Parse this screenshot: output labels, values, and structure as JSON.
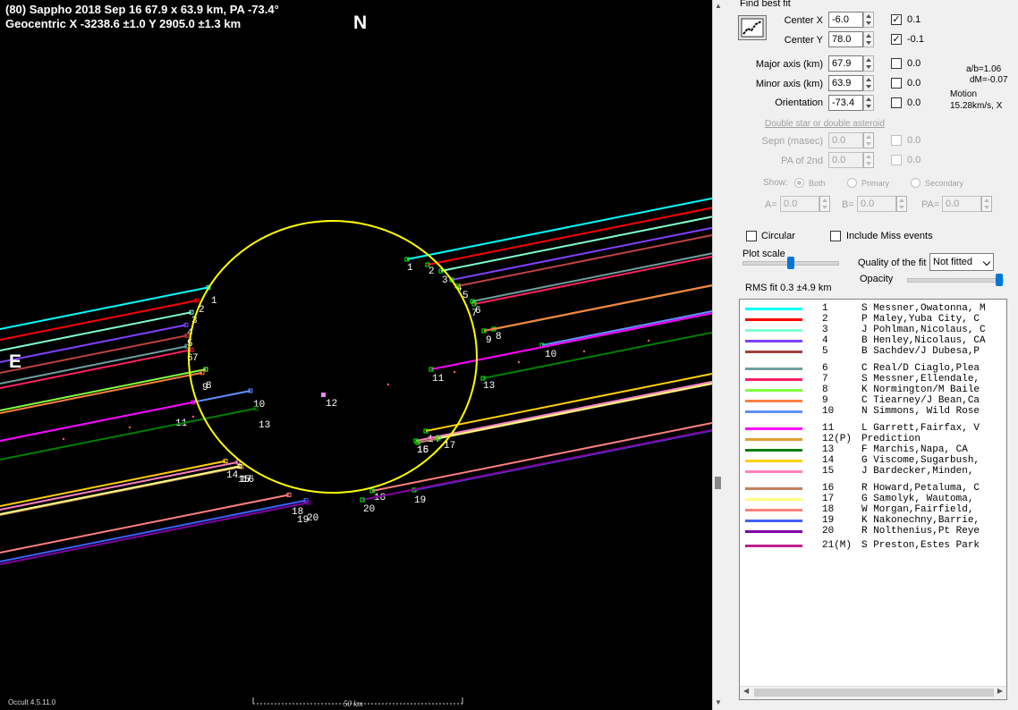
{
  "plot": {
    "title_line1": "(80) Sappho  2018 Sep 16  67.9 x 63.9 km, PA -73.4°",
    "title_line2": "Geocentric  X  -3238.6 ±1.0  Y 2905.0 ±1.3 km",
    "north_label": "N",
    "east_label": "E",
    "version": "Occult 4.5.11.0",
    "scale_label": "50 km",
    "center_label": "12",
    "ellipse_color": "#ffff00",
    "chords": [
      {
        "id": "1",
        "color": "#00ffff"
      },
      {
        "id": "2",
        "color": "#ff0000"
      },
      {
        "id": "3",
        "color": "#80ffd0"
      },
      {
        "id": "4",
        "color": "#8040ff"
      },
      {
        "id": "5",
        "color": "#c04040"
      },
      {
        "id": "6",
        "color": "#70a0a0"
      },
      {
        "id": "7",
        "color": "#ff2060"
      },
      {
        "id": "8",
        "color": "#80ff40"
      },
      {
        "id": "9",
        "color": "#ff8040"
      },
      {
        "id": "10",
        "color": "#6090ff"
      },
      {
        "id": "11",
        "color": "#ff00ff"
      },
      {
        "id": "13",
        "color": "#008000"
      },
      {
        "id": "14",
        "color": "#ffd000"
      },
      {
        "id": "15",
        "color": "#ff80c0"
      },
      {
        "id": "16",
        "color": "#c08060"
      },
      {
        "id": "17",
        "color": "#ffff80"
      },
      {
        "id": "18",
        "color": "#ff8080"
      },
      {
        "id": "19",
        "color": "#4060ff"
      },
      {
        "id": "20",
        "color": "#8000a0"
      }
    ]
  },
  "panel": {
    "find_best_fit": "Find best fit",
    "center_x": {
      "label": "Center X",
      "value": "-6.0",
      "check": "✓",
      "err": "0.1"
    },
    "center_y": {
      "label": "Center Y",
      "value": "78.0",
      "check": "✓",
      "err": "-0.1"
    },
    "major": {
      "label": "Major axis (km)",
      "value": "67.9",
      "err": "0.0"
    },
    "minor": {
      "label": "Minor axis (km)",
      "value": "63.9",
      "err": "0.0"
    },
    "orient": {
      "label": "Orientation",
      "value": "-73.4",
      "err": "0.0"
    },
    "ab_ratio": "a/b=1.06",
    "dm": "dM=-0.07",
    "motion_label": "Motion",
    "motion_value": "15.28km/s, X",
    "double_heading": "Double star  or  double asteroid",
    "sepn": {
      "label": "Sepn (masec)",
      "value": "0.0",
      "err": "0.0"
    },
    "pa2": {
      "label": "PA of 2nd",
      "value": "0.0",
      "err": "0.0"
    },
    "show_label": "Show:",
    "show_both": "Both",
    "show_primary": "Primary",
    "show_secondary": "Secondary",
    "a_label": "A=",
    "a_value": "0.0",
    "b_label": "B=",
    "b_value": "0.0",
    "pa_label": "PA=",
    "pa_value": "0.0",
    "circular": "Circular",
    "include_miss": "Include Miss events",
    "plot_scale": "Plot scale",
    "quality_label": "Quality of the fit",
    "quality_value": "Not fitted",
    "opacity": "Opacity",
    "rms_fit": "RMS fit 0.3 ±4.9 km"
  },
  "legend": [
    {
      "code": "1",
      "name": "S Messner,Owatonna, M",
      "color": "#00ffff"
    },
    {
      "code": "2",
      "name": "P Maley,Yuba City, C",
      "color": "#ff0000"
    },
    {
      "code": "3",
      "name": "J Pohlman,Nicolaus, C",
      "color": "#80ffd0"
    },
    {
      "code": "4",
      "name": "B Henley,Nicolaus, CA",
      "color": "#8040ff"
    },
    {
      "code": "5",
      "name": "B Sachdev/J Dubesa,P",
      "color": "#a04040"
    },
    {
      "code": "6",
      "name": "C Real/D Ciaglo,Plea",
      "color": "#70a0a0"
    },
    {
      "code": "7",
      "name": "S Messner,Ellendale,",
      "color": "#ff2060"
    },
    {
      "code": "8",
      "name": "K Normington/M Baile",
      "color": "#80ff40"
    },
    {
      "code": "9",
      "name": "C Tiearney/J Bean,Ca",
      "color": "#ff8040"
    },
    {
      "code": "10",
      "name": "N Simmons, Wild Rose",
      "color": "#6090ff"
    },
    {
      "code": "11",
      "name": "L Garrett,Fairfax, V",
      "color": "#ff00ff"
    },
    {
      "code": "12(P)",
      "name": "Prediction",
      "color": "#e0a030"
    },
    {
      "code": "13",
      "name": "F Marchis,Napa, CA",
      "color": "#008000"
    },
    {
      "code": "14",
      "name": "G Viscome,Sugarbush,",
      "color": "#ffd000"
    },
    {
      "code": "15",
      "name": "J Bardecker,Minden, ",
      "color": "#ff80c0"
    },
    {
      "code": "16",
      "name": "R Howard,Petaluma, C",
      "color": "#c08060"
    },
    {
      "code": "17",
      "name": "G Samolyk, Wautoma, ",
      "color": "#ffff80"
    },
    {
      "code": "18",
      "name": "W Morgan,Fairfield, ",
      "color": "#ff8080"
    },
    {
      "code": "19",
      "name": "K Nakonechny,Barrie,",
      "color": "#4060ff"
    },
    {
      "code": "20",
      "name": "R Nolthenius,Pt Reye",
      "color": "#8000a0"
    },
    {
      "code": "21(M)",
      "name": "S Preston,Estes Park",
      "color": "#c02090"
    }
  ]
}
